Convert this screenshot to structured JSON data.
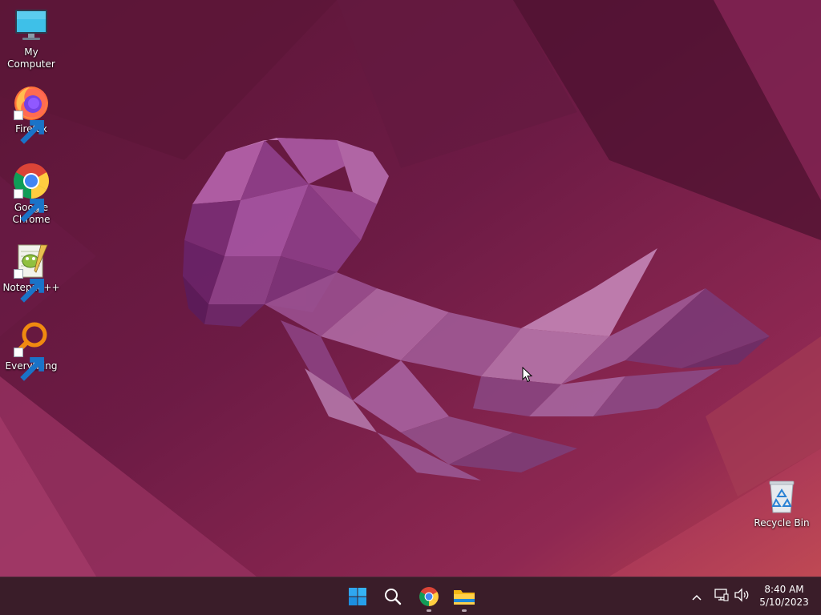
{
  "desktop": {
    "icons": [
      {
        "label": "My Computer",
        "icon": "monitor-icon"
      },
      {
        "label": "Firefox",
        "icon": "firefox-icon"
      },
      {
        "label": "Google Chrome",
        "icon": "chrome-icon"
      },
      {
        "label": "Notepad++",
        "icon": "notepadpp-icon"
      },
      {
        "label": "Everything",
        "icon": "everything-search-icon"
      }
    ],
    "recycle_bin": {
      "label": "Recycle Bin",
      "icon": "recycle-bin-icon"
    }
  },
  "taskbar": {
    "apps": [
      {
        "name": "Start",
        "icon": "windows-start-icon",
        "running": false
      },
      {
        "name": "Search",
        "icon": "search-icon",
        "running": false
      },
      {
        "name": "Google Chrome",
        "icon": "chrome-icon",
        "running": true
      },
      {
        "name": "File Explorer",
        "icon": "folder-icon",
        "running": true
      }
    ],
    "tray": {
      "overflow_icon": "chevron-up-icon",
      "network_icon": "network-icon",
      "volume_icon": "speaker-icon",
      "time": "8:40 AM",
      "date": "5/10/2023"
    }
  },
  "colors": {
    "taskbar_bg": "#3a1d29",
    "wallpaper_base": "#6e1a45",
    "wallpaper_accent": "#a83552",
    "jellyfish": "#9b4c8a"
  }
}
